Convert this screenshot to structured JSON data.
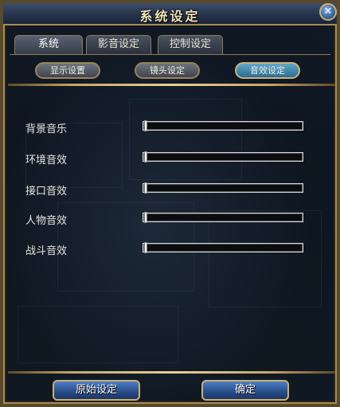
{
  "window": {
    "title": "系统设定",
    "close_symbol": "✕"
  },
  "tabs": [
    {
      "label": "系统",
      "active": true
    },
    {
      "label": "影音设定",
      "active": false
    },
    {
      "label": "控制设定",
      "active": false
    }
  ],
  "subtabs": [
    {
      "label": "显示设置",
      "active": false
    },
    {
      "label": "镜头设定",
      "active": false
    },
    {
      "label": "音效设定",
      "active": true
    }
  ],
  "sound_settings": [
    {
      "label": "背景音乐",
      "level": 0
    },
    {
      "label": "环境音效",
      "level": 0
    },
    {
      "label": "接口音效",
      "level": 0
    },
    {
      "label": "人物音效",
      "level": 0
    },
    {
      "label": "战斗音效",
      "level": 0
    }
  ],
  "footer": {
    "reset_label": "原始设定",
    "confirm_label": "确定"
  },
  "colors": {
    "accent_gold": "#c9b074",
    "button_blue": "#2a4f8c",
    "active_subtab": "#2c6b8f"
  },
  "icons": {
    "close": "close-icon"
  }
}
